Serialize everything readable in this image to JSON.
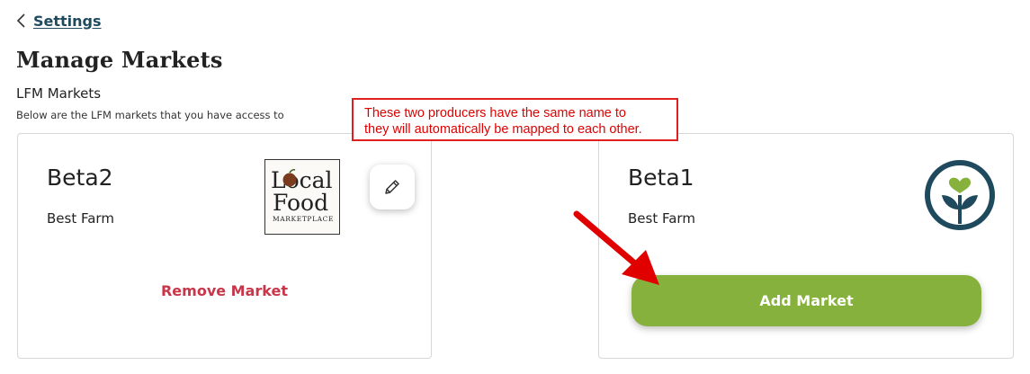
{
  "header": {
    "back_label": "Settings",
    "page_title": "Manage Markets"
  },
  "section": {
    "title": "LFM Markets",
    "subtitle": "Below are the LFM markets that you have access to"
  },
  "annotation": {
    "line1": "These two producers have the same name to",
    "line2": "they will automatically be mapped to each other."
  },
  "cards": [
    {
      "market_name": "Beta2",
      "producer_name": "Best Farm",
      "logo": {
        "line1": "Local",
        "line2": "Food",
        "line3": "MARKETPLACE"
      },
      "edit_icon": "pencil-icon",
      "action_label": "Remove Market"
    },
    {
      "market_name": "Beta1",
      "producer_name": "Best Farm",
      "logo_icon": "heart-sprout-logo",
      "action_label": "Add Market"
    }
  ],
  "colors": {
    "link": "#1f4a5e",
    "remove": "#c8364a",
    "add_button": "#86b13c",
    "annotation": "#e00000",
    "lfm_logo_teal": "#1f4a5e",
    "lfm_logo_green": "#86b13c"
  }
}
